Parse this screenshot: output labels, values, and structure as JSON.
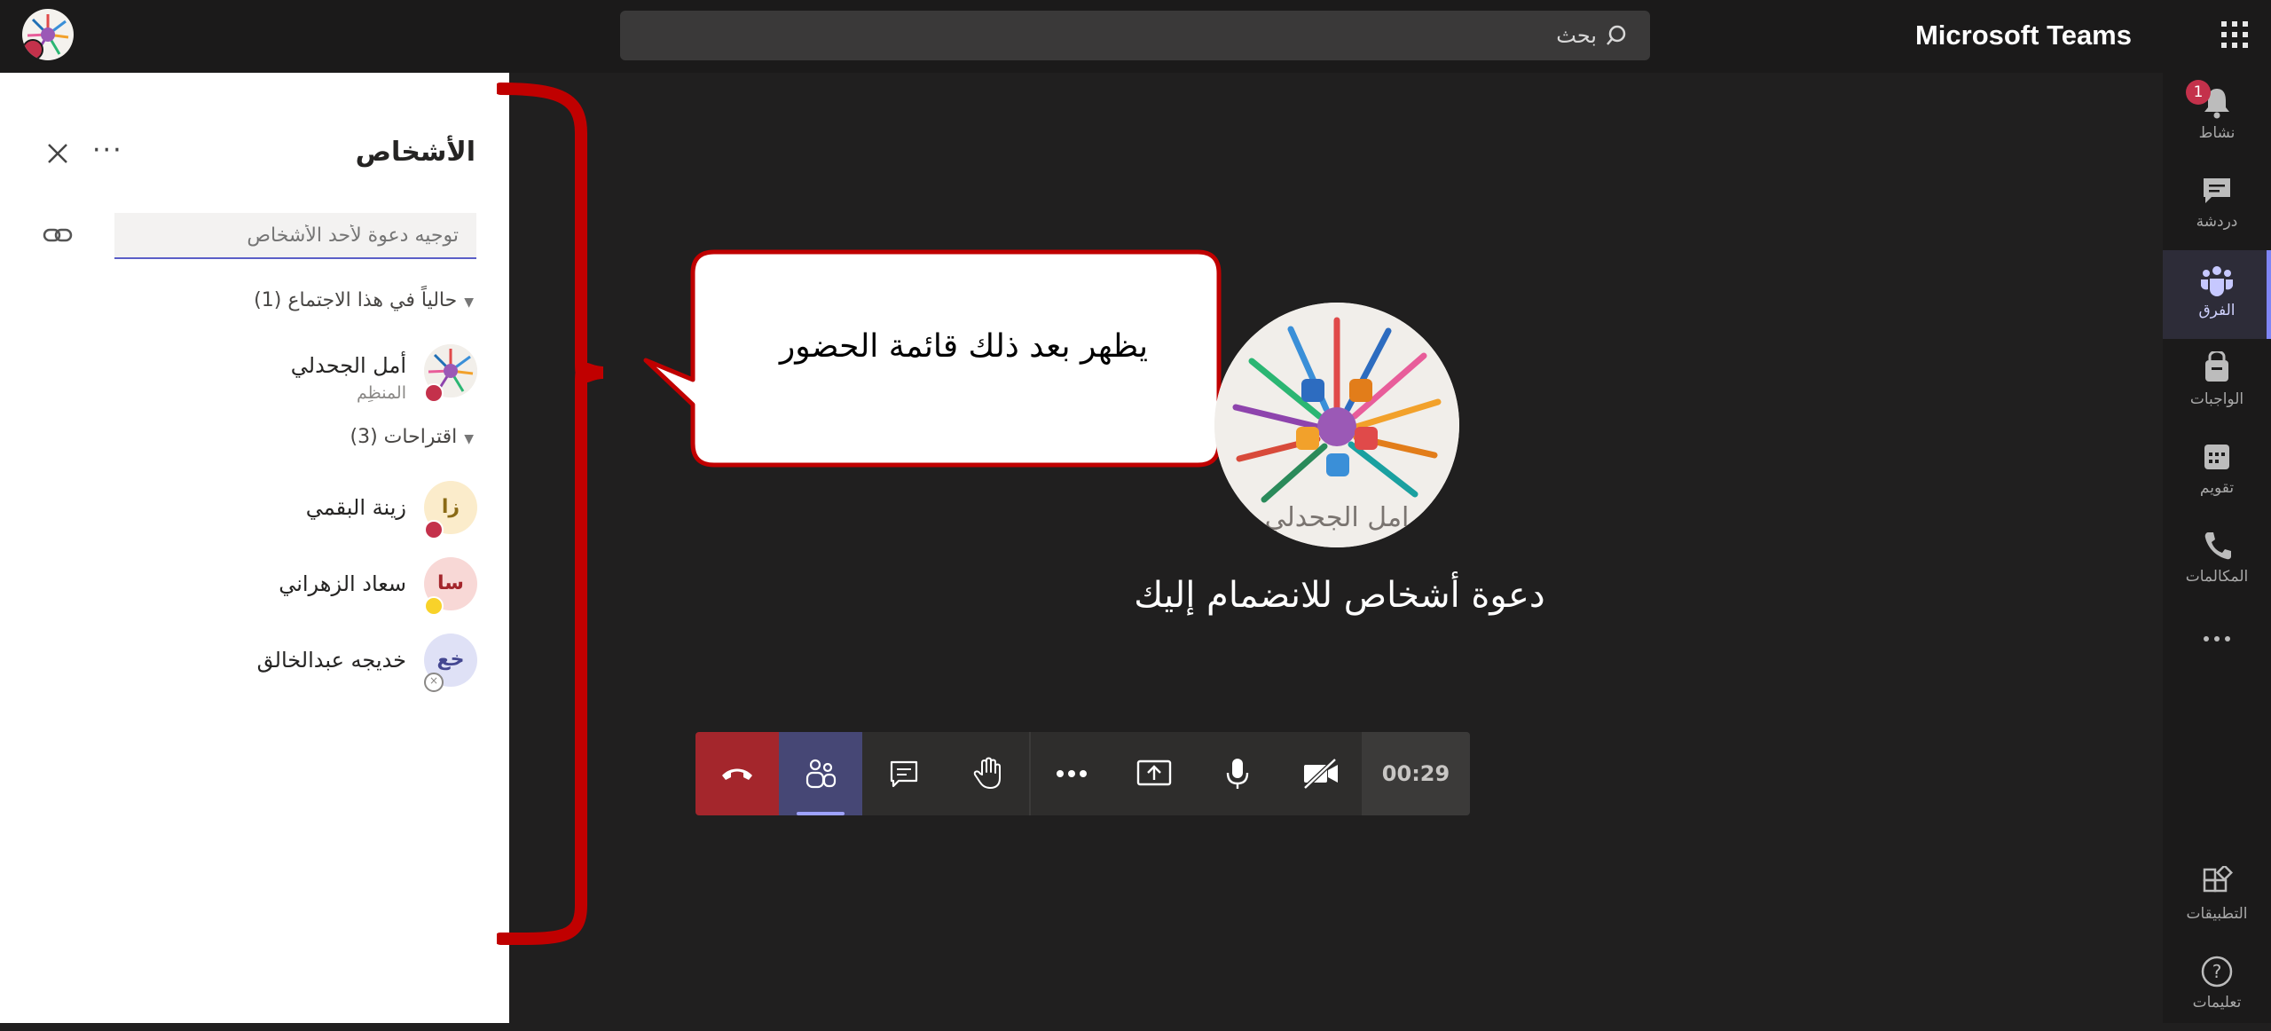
{
  "app": {
    "title": "Microsoft Teams"
  },
  "search": {
    "placeholder": "بحث"
  },
  "rail": {
    "activity_badge": "1",
    "items": [
      {
        "label": "نشاط",
        "icon": "bell-icon"
      },
      {
        "label": "دردشة",
        "icon": "chat-icon"
      },
      {
        "label": "الفرق",
        "icon": "teams-icon"
      },
      {
        "label": "الواجبات",
        "icon": "assignments-icon"
      },
      {
        "label": "تقويم",
        "icon": "calendar-icon"
      },
      {
        "label": "المكالمات",
        "icon": "phone-icon"
      },
      {
        "label": "التطبيقات",
        "icon": "apps-icon"
      },
      {
        "label": "تعليمات",
        "icon": "help-icon"
      }
    ]
  },
  "people_panel": {
    "title": "الأشخاص",
    "more": "···",
    "invite_placeholder": "توجيه دعوة لأحد الأشخاص",
    "in_meeting_header": "حالياً في هذا الاجتماع (1)",
    "suggestions_header": "اقتراحات (3)",
    "in_meeting": [
      {
        "name": "أمل الجحدلي",
        "role": "المنظِم",
        "status_color": "#c4314b"
      }
    ],
    "suggestions": [
      {
        "name": "زينة البقمي",
        "initials": "زا",
        "avatar_bg": "#fbeccb",
        "avatar_fg": "#8a6a16",
        "status_color": "#c4314b"
      },
      {
        "name": "سعاد الزهراني",
        "initials": "سا",
        "avatar_bg": "#f8d8d6",
        "avatar_fg": "#a4262c",
        "status_color": "#f8d22a"
      },
      {
        "name": "خديجه عبدالخالق",
        "initials": "خع",
        "avatar_bg": "#dfe1f6",
        "avatar_fg": "#444791",
        "status_color": "#ffffff"
      }
    ]
  },
  "callout": {
    "text": "يظهر بعد ذلك قائمة الحضور"
  },
  "main": {
    "avatar_caption": "امل الجحدلي",
    "invite_heading": "دعوة أشخاص للانضمام إليك"
  },
  "toolbar": {
    "timer": "00:29",
    "buttons": [
      "hang-up",
      "participants",
      "chat",
      "raise-hand",
      "more-actions",
      "share",
      "microphone",
      "camera-off"
    ]
  },
  "colors": {
    "accent": "#5b5fc7",
    "hangup": "#a4262c",
    "annotation_red": "#c00000"
  }
}
